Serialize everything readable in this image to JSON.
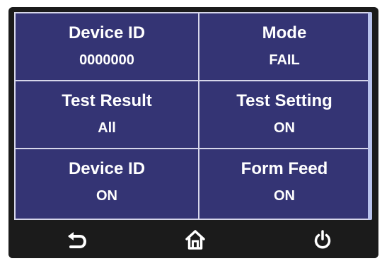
{
  "settings": [
    {
      "label": "Device ID",
      "value": "0000000"
    },
    {
      "label": "Mode",
      "value": "FAIL"
    },
    {
      "label": "Test Result",
      "value": "All"
    },
    {
      "label": "Test Setting",
      "value": "ON"
    },
    {
      "label": "Device ID",
      "value": "ON"
    },
    {
      "label": "Form Feed",
      "value": "ON"
    }
  ],
  "nav": {
    "icons": [
      "back-icon",
      "home-icon",
      "power-icon"
    ]
  },
  "colors": {
    "panel": "#343474",
    "grid_lines": "#d6d6ea",
    "bezel": "#1b1b1b",
    "scrollbar": "#b8c2ec",
    "text": "#ffffff"
  }
}
